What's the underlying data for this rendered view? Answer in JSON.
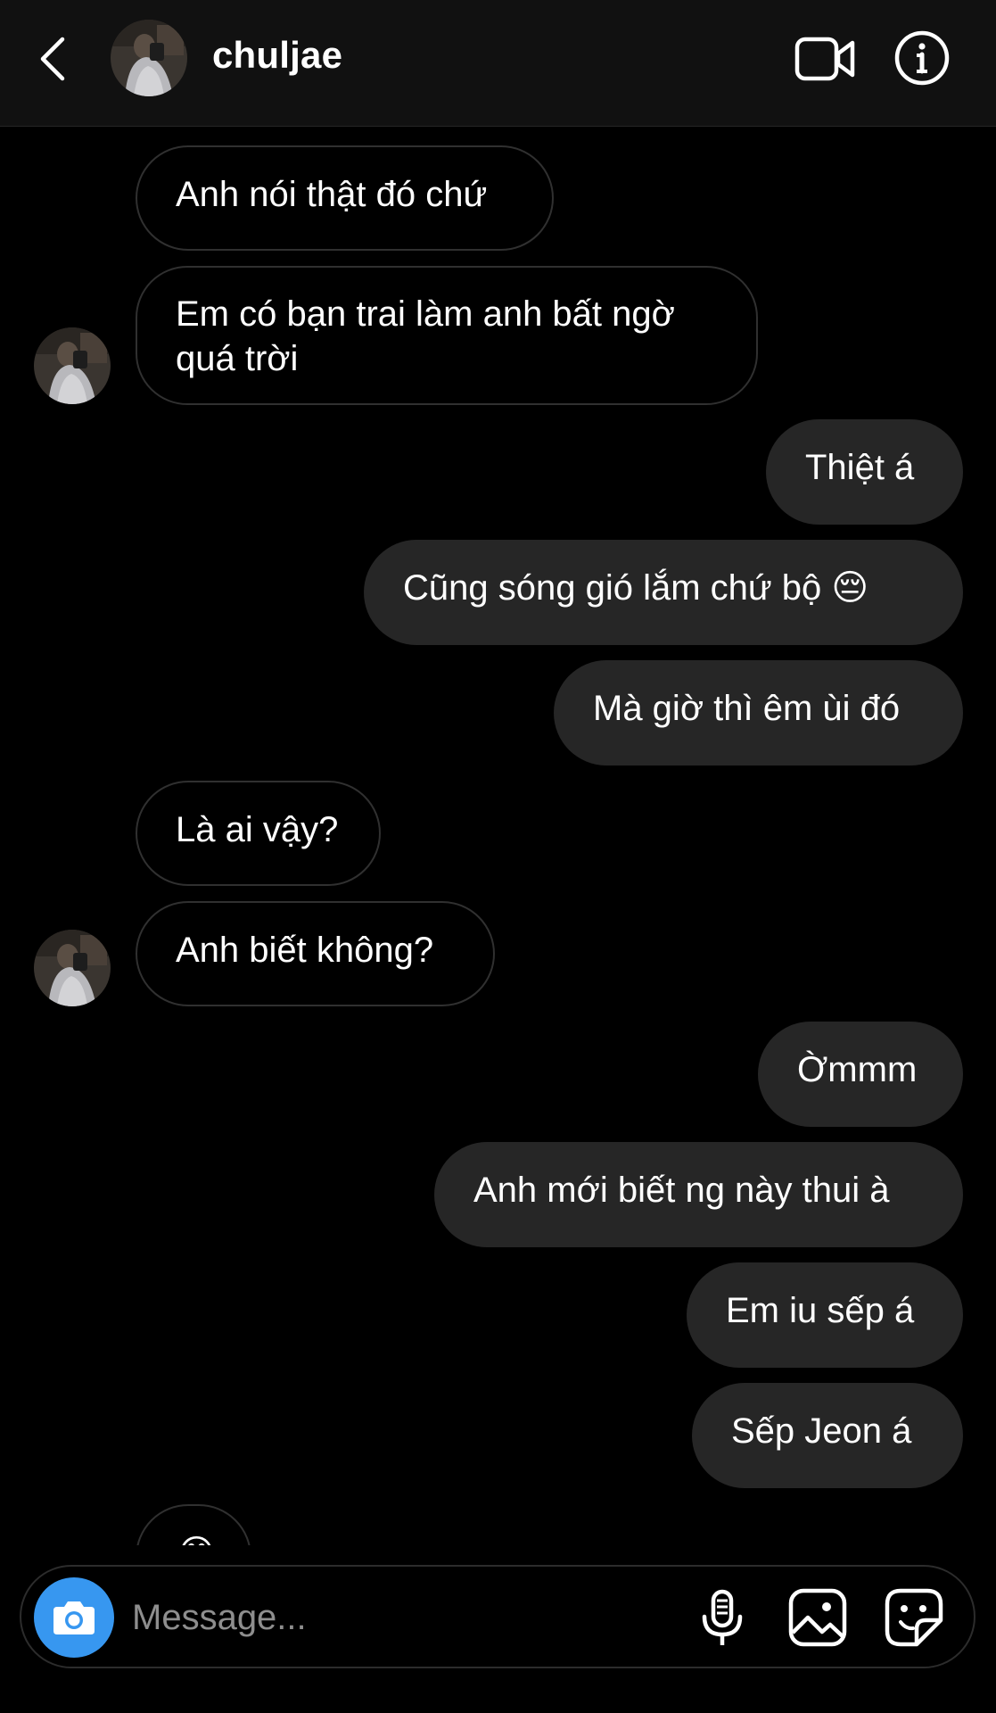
{
  "header": {
    "username": "chuljae"
  },
  "messages": [
    {
      "side": "in",
      "text": "Anh nói thật đó chứ"
    },
    {
      "side": "in",
      "text": "Em có bạn trai làm anh bất ngờ quá trời"
    },
    {
      "side": "out",
      "text": "Thiệt á"
    },
    {
      "side": "out",
      "text": "Cũng sóng gió lắm chứ bộ 😔"
    },
    {
      "side": "out",
      "text": "Mà giờ thì êm ùi đó"
    },
    {
      "side": "in",
      "text": "Là ai vậy?"
    },
    {
      "side": "in",
      "text": "Anh biết không?"
    },
    {
      "side": "out",
      "text": "Ờmmm"
    },
    {
      "side": "out",
      "text": "Anh mới biết ng này thui à"
    },
    {
      "side": "out",
      "text": "Em iu sếp á"
    },
    {
      "side": "out",
      "text": "Sếp Jeon á"
    },
    {
      "side": "in",
      "text": "😂"
    }
  ],
  "composer": {
    "placeholder": "Message..."
  },
  "icons": {
    "back": "chevron-left-icon",
    "video": "video-camera-icon",
    "info": "info-icon",
    "camera": "camera-icon",
    "mic": "microphone-icon",
    "gallery": "image-icon",
    "sticker": "sticker-icon"
  },
  "colors": {
    "background": "#000000",
    "header": "#111111",
    "outgoing_bubble": "#262626",
    "incoming_border": "#303030",
    "camera_button": "#3797f0",
    "placeholder": "#8e8e8e"
  }
}
